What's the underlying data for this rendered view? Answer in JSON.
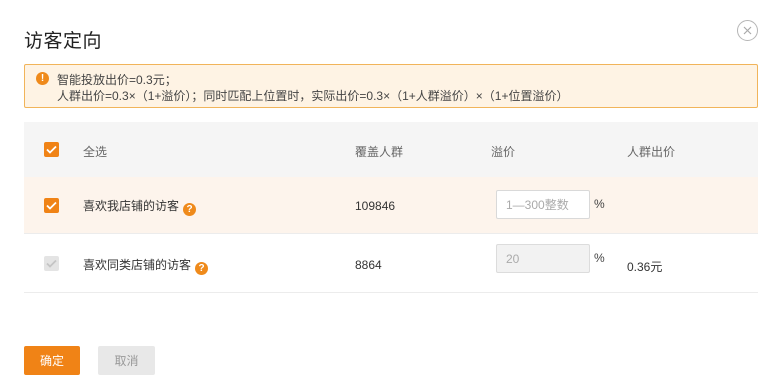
{
  "dialog": {
    "title": "访客定向",
    "close_icon": "close-circle-icon"
  },
  "notice": {
    "icon": "alert-icon",
    "line1": "智能投放出价=0.3元；",
    "line2": "人群出价=0.3×（1+溢价）；同时匹配上位置时，实际出价=0.3×（1+人群溢价）×（1+位置溢价）"
  },
  "table": {
    "headers": {
      "select_all": "全选",
      "coverage": "覆盖人群",
      "premium": "溢价",
      "crowd_bid": "人群出价"
    },
    "rows": [
      {
        "checked": true,
        "disabled": false,
        "name": "喜欢我店铺的访客",
        "coverage": "109846",
        "premium_value": "",
        "premium_placeholder": "1—300整数",
        "unit": "%",
        "crowd_bid": ""
      },
      {
        "checked": true,
        "disabled": true,
        "name": "喜欢同类店铺的访客",
        "coverage": "8864",
        "premium_value": "",
        "premium_placeholder": "20",
        "unit": "%",
        "crowd_bid": "0.36元"
      }
    ]
  },
  "footer": {
    "confirm_label": "确定",
    "cancel_label": "取消"
  },
  "colors": {
    "accent": "#f08316",
    "notice_bg": "#fef3e4",
    "notice_border": "#f1b45a",
    "selected_row": "#fdf4ec"
  }
}
